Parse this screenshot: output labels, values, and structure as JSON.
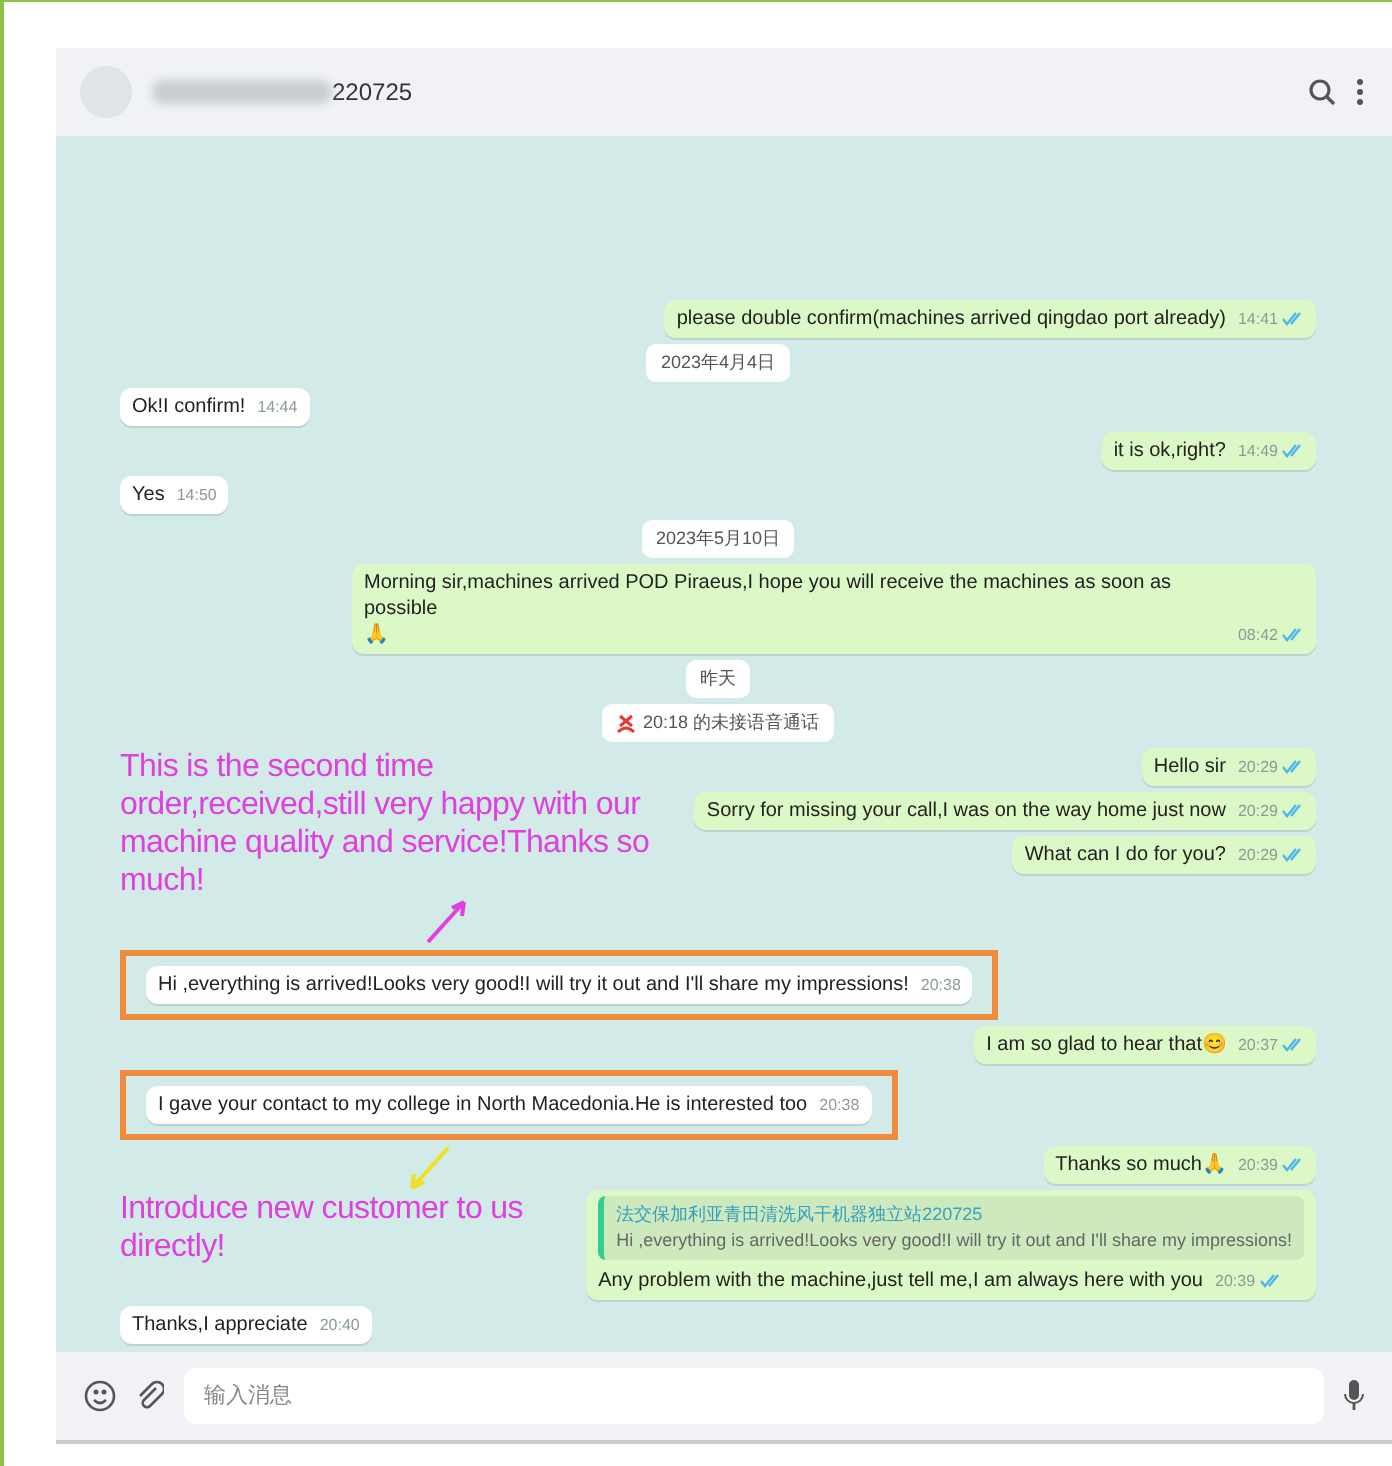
{
  "header": {
    "contact": "220725"
  },
  "messages": [
    {
      "kind": "sent",
      "text": "please double confirm(machines arrived qingdao port already)",
      "time": "14:41",
      "read": true
    },
    {
      "kind": "date",
      "text": "2023年4月4日"
    },
    {
      "kind": "received",
      "text": "Ok!I confirm!",
      "time": "14:44",
      "highlighted": false
    },
    {
      "kind": "sent",
      "text": "it is ok,right?",
      "time": "14:49",
      "read": true
    },
    {
      "kind": "received",
      "text": "Yes",
      "time": "14:50",
      "highlighted": false
    },
    {
      "kind": "date",
      "text": "2023年5月10日"
    },
    {
      "kind": "sent",
      "text": "Morning sir,machines arrived POD Piraeus,I hope you will receive the machines as soon as possible\n🙏",
      "time": "08:42",
      "read": true
    },
    {
      "kind": "date",
      "text": "昨天"
    },
    {
      "kind": "call",
      "text": "20:18 的未接语音通话"
    },
    {
      "kind": "annotation",
      "text": "This is the second time order,received,still very happy with our machine quality and service!Thanks so much!",
      "arrow_above": false,
      "color": "#e040e0"
    },
    {
      "kind": "sent",
      "text": "Hello sir",
      "time": "20:29",
      "read": true
    },
    {
      "kind": "sent",
      "text": "Sorry for missing your call,I was on the way home just now",
      "time": "20:29",
      "read": true
    },
    {
      "kind": "sent",
      "text": "What can I do for you?",
      "time": "20:29",
      "read": true
    },
    {
      "kind": "received",
      "text": "Hi ,everything is arrived!Looks very good!I will try it out and I'll share my impressions!",
      "time": "20:38",
      "highlighted": true
    },
    {
      "kind": "sent",
      "text": "I am so glad to hear that😊",
      "time": "20:37",
      "read": true
    },
    {
      "kind": "received",
      "text": "I gave your contact to my college in North Macedonia.He is interested too",
      "time": "20:38",
      "highlighted": true
    },
    {
      "kind": "annotation",
      "text": "Introduce new customer to us directly!",
      "arrow_above": true,
      "color": "#f0e020"
    },
    {
      "kind": "sent",
      "text": "Thanks so much🙏",
      "time": "20:39",
      "read": true
    },
    {
      "kind": "sent",
      "quote": {
        "author": "法交保加利亚青田清洗风干机器独立站220725",
        "text": "Hi ,everything is arrived!Looks very good!I will try it out and I'll share my impressions!"
      },
      "text": "Any problem with the machine,just tell me,I am always here with you",
      "time": "20:39",
      "read": true
    },
    {
      "kind": "received",
      "text": "Thanks,I appreciate",
      "time": "20:40",
      "highlighted": false
    }
  ],
  "composer": {
    "placeholder": "输入消息"
  }
}
